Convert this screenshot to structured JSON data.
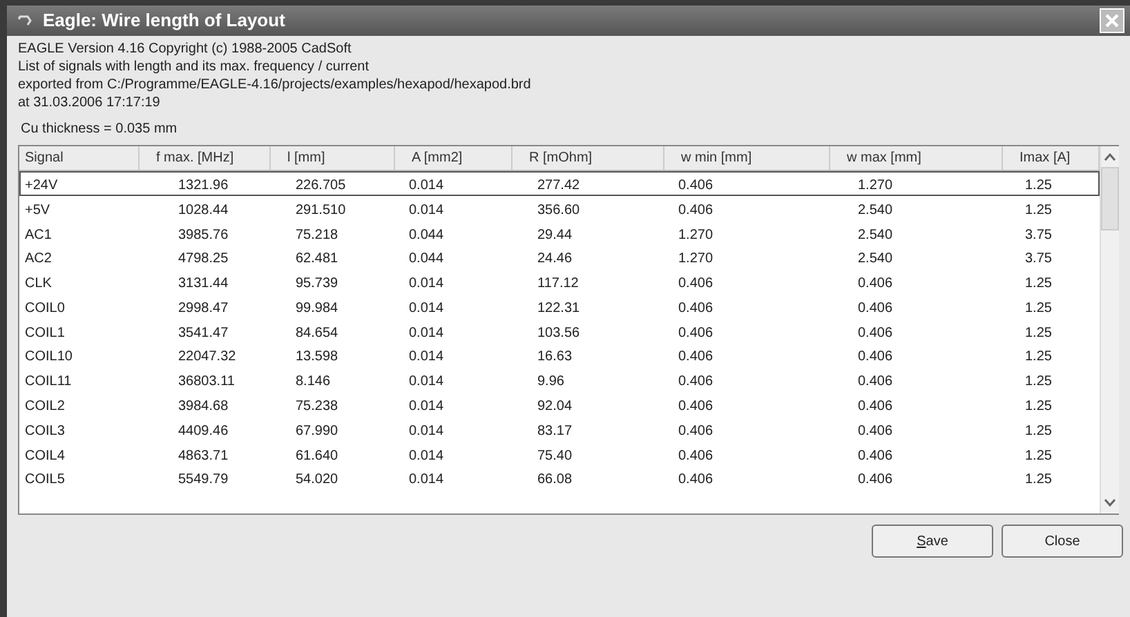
{
  "window": {
    "title": "Eagle: Wire length of Layout"
  },
  "info_lines": [
    "EAGLE Version 4.16 Copyright (c) 1988-2005 CadSoft",
    "List of signals with length and its max. frequency / current",
    "exported from C:/Programme/EAGLE-4.16/projects/examples/hexapod/hexapod.brd",
    "at 31.03.2006 17:17:19"
  ],
  "thickness": "Cu thickness = 0.035 mm",
  "table": {
    "columns": [
      "Signal",
      "f max. [MHz]",
      "l [mm]",
      "A [mm2]",
      "R [mOhm]",
      "w min [mm]",
      "w max [mm]",
      "Imax [A]"
    ],
    "rows": [
      {
        "selected": true,
        "cells": [
          "+24V",
          "1321.96",
          "226.705",
          "0.014",
          "277.42",
          "0.406",
          "1.270",
          "1.25"
        ]
      },
      {
        "selected": false,
        "cells": [
          "+5V",
          "1028.44",
          "291.510",
          "0.014",
          "356.60",
          "0.406",
          "2.540",
          "1.25"
        ]
      },
      {
        "selected": false,
        "cells": [
          "AC1",
          "3985.76",
          "75.218",
          "0.044",
          "29.44",
          "1.270",
          "2.540",
          "3.75"
        ]
      },
      {
        "selected": false,
        "cells": [
          "AC2",
          "4798.25",
          "62.481",
          "0.044",
          "24.46",
          "1.270",
          "2.540",
          "3.75"
        ]
      },
      {
        "selected": false,
        "cells": [
          "CLK",
          "3131.44",
          "95.739",
          "0.014",
          "117.12",
          "0.406",
          "0.406",
          "1.25"
        ]
      },
      {
        "selected": false,
        "cells": [
          "COIL0",
          "2998.47",
          "99.984",
          "0.014",
          "122.31",
          "0.406",
          "0.406",
          "1.25"
        ]
      },
      {
        "selected": false,
        "cells": [
          "COIL1",
          "3541.47",
          "84.654",
          "0.014",
          "103.56",
          "0.406",
          "0.406",
          "1.25"
        ]
      },
      {
        "selected": false,
        "cells": [
          "COIL10",
          "22047.32",
          "13.598",
          "0.014",
          "16.63",
          "0.406",
          "0.406",
          "1.25"
        ]
      },
      {
        "selected": false,
        "cells": [
          "COIL11",
          "36803.11",
          "8.146",
          "0.014",
          "9.96",
          "0.406",
          "0.406",
          "1.25"
        ]
      },
      {
        "selected": false,
        "cells": [
          "COIL2",
          "3984.68",
          "75.238",
          "0.014",
          "92.04",
          "0.406",
          "0.406",
          "1.25"
        ]
      },
      {
        "selected": false,
        "cells": [
          "COIL3",
          "4409.46",
          "67.990",
          "0.014",
          "83.17",
          "0.406",
          "0.406",
          "1.25"
        ]
      },
      {
        "selected": false,
        "cells": [
          "COIL4",
          "4863.71",
          "61.640",
          "0.014",
          "75.40",
          "0.406",
          "0.406",
          "1.25"
        ]
      },
      {
        "selected": false,
        "cells": [
          "COIL5",
          "5549.79",
          "54.020",
          "0.014",
          "66.08",
          "0.406",
          "0.406",
          "1.25"
        ]
      }
    ]
  },
  "buttons": [
    "Save",
    "Close"
  ]
}
